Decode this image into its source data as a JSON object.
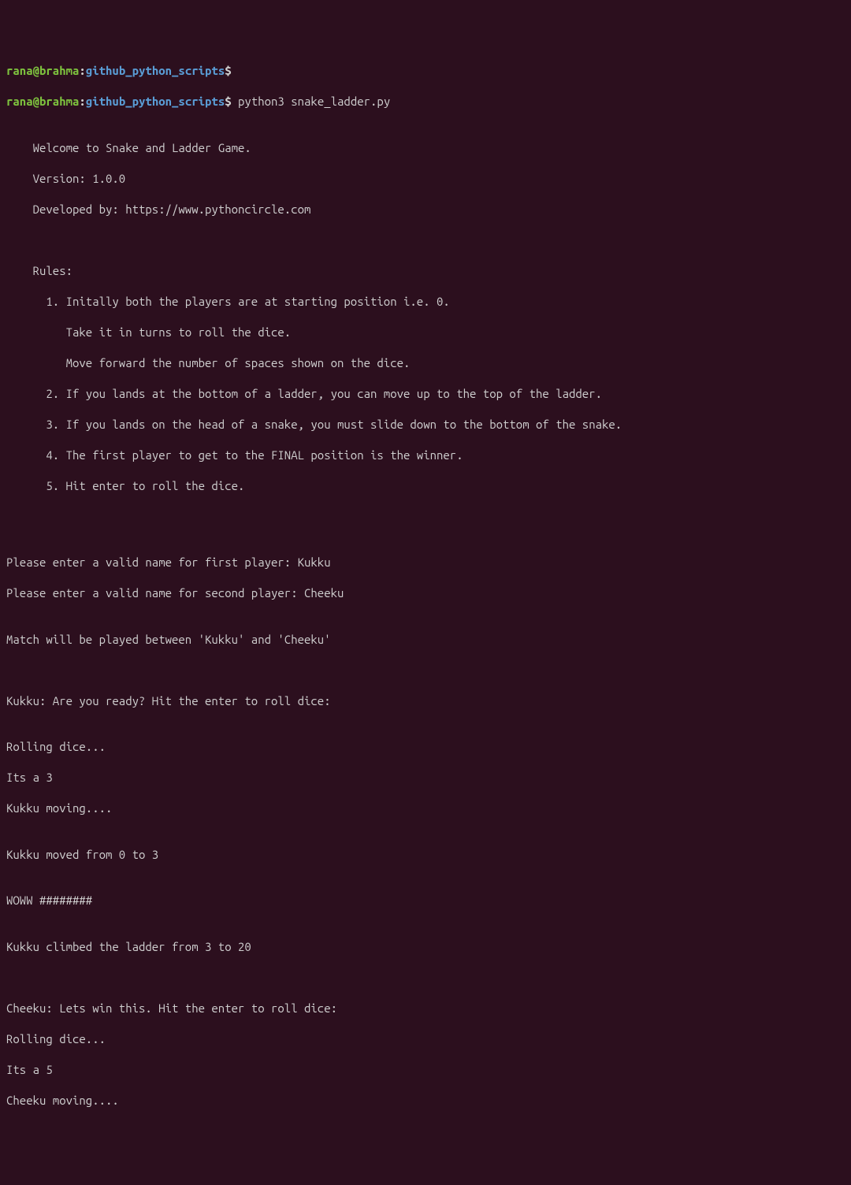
{
  "prompt": {
    "user": "rana@brahma",
    "sep": ":",
    "path": "github_python_scripts",
    "dollar": "$"
  },
  "command": " python3 snake_ladder.py",
  "blank": "",
  "welcome": {
    "l1": "    Welcome to Snake and Ladder Game.",
    "l2": "    Version: 1.0.0",
    "l3": "    Developed by: https://www.pythoncircle.com",
    "l4": "    ",
    "l5": "    Rules:",
    "l6": "      1. Initally both the players are at starting position i.e. 0.",
    "l7": "         Take it in turns to roll the dice.",
    "l8": "         Move forward the number of spaces shown on the dice.",
    "l9": "      2. If you lands at the bottom of a ladder, you can move up to the top of the ladder.",
    "l10": "      3. If you lands on the head of a snake, you must slide down to the bottom of the snake.",
    "l11": "      4. The first player to get to the FINAL position is the winner.",
    "l12": "      5. Hit enter to roll the dice.",
    "l13": "    "
  },
  "inputs": {
    "p1": "Please enter a valid name for first player: Kukku",
    "p2": "Please enter a valid name for second player: Cheeku"
  },
  "match": "Match will be played between 'Kukku' and 'Cheeku'",
  "turn1": {
    "prompt": "Kukku: Are you ready? Hit the enter to roll dice: ",
    "rolling": "Rolling dice...",
    "result": "Its a 3",
    "moving": "Kukku moving....",
    "moved": "Kukku moved from 0 to 3",
    "woww": "WOWW ########",
    "ladder": "Kukku climbed the ladder from 3 to 20"
  },
  "turn2": {
    "prompt": "Cheeku: Lets win this. Hit the enter to roll dice: ",
    "rolling": "Rolling dice...",
    "result": "Its a 5",
    "moving": "Cheeku moving...."
  }
}
